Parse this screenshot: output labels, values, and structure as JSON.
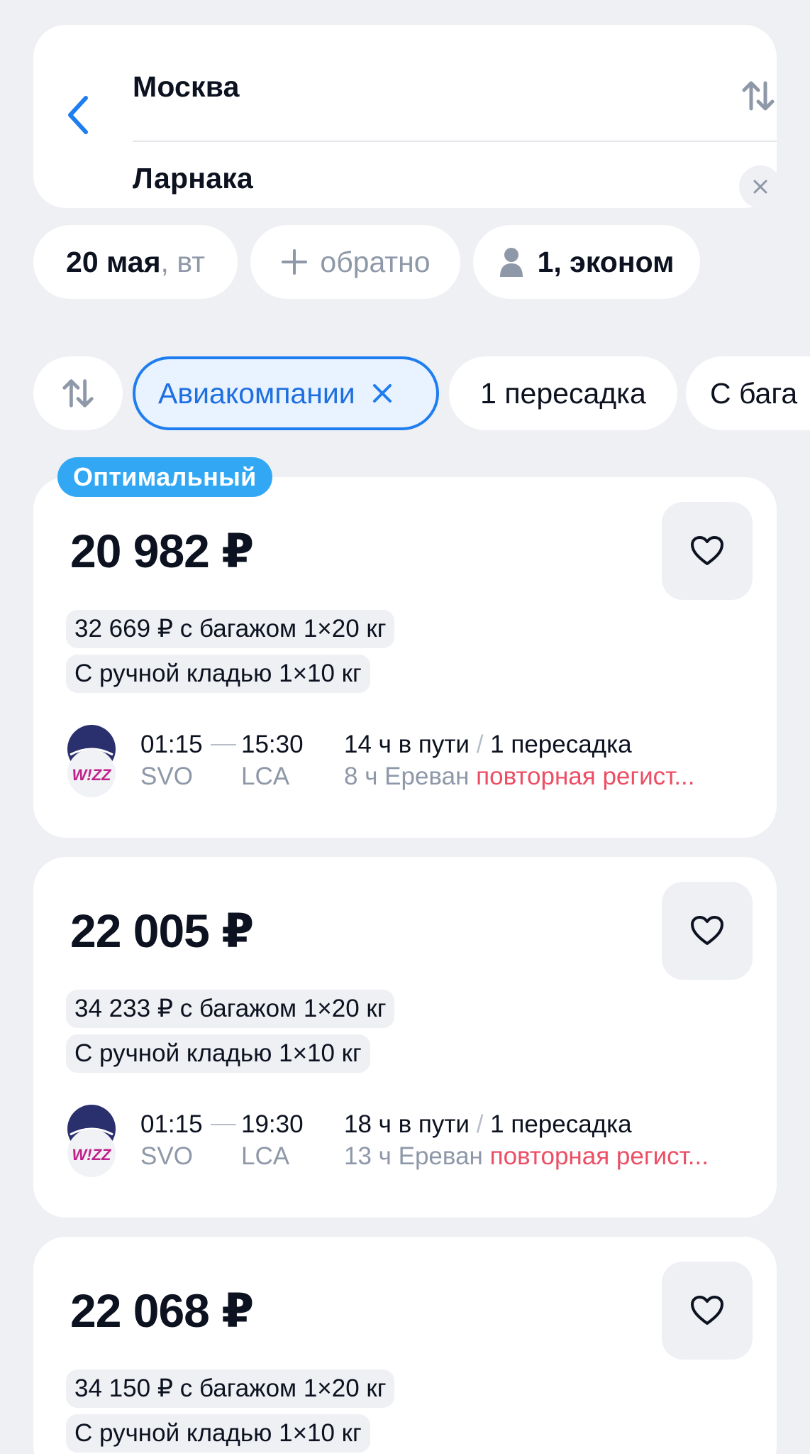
{
  "search": {
    "from": "Москва",
    "to": "Ларнака"
  },
  "params": {
    "date": "20 мая",
    "weekday": ", вт",
    "return_label": "обратно",
    "passengers": "1, эконом"
  },
  "filters": {
    "airlines": "Авиакомпании",
    "transfer": "1 пересадка",
    "baggage": "С бага"
  },
  "badge": "Оптимальный",
  "tickets": [
    {
      "price": "20 982 ₽",
      "baggage_price": "32 669 ₽ с багажом 1×20 кг",
      "hand_luggage": "С ручной кладью 1×10 кг",
      "depart_time": "01:15",
      "arrive_time": "15:30",
      "depart_code": "SVO",
      "arrive_code": "LCA",
      "duration": "14 ч в пути",
      "transfers": "1 пересадка",
      "layover": "8 ч Ереван",
      "warning": "повторная регист..."
    },
    {
      "price": "22 005 ₽",
      "baggage_price": "34 233 ₽ с багажом 1×20 кг",
      "hand_luggage": "С ручной кладью 1×10 кг",
      "depart_time": "01:15",
      "arrive_time": "19:30",
      "depart_code": "SVO",
      "arrive_code": "LCA",
      "duration": "18 ч в пути",
      "transfers": "1 пересадка",
      "layover": "13 ч Ереван",
      "warning": "повторная регист..."
    },
    {
      "price": "22 068 ₽",
      "baggage_price": "34 150 ₽ с багажом 1×20 кг",
      "hand_luggage": "С ручной кладью 1×10 кг"
    }
  ],
  "icons": {
    "back": "chevron-left-icon",
    "swap": "swap-vertical-icon",
    "clear": "close-icon",
    "plus": "plus-icon",
    "person": "person-icon",
    "sort": "sort-icon",
    "remove_filter": "close-icon",
    "favorite": "heart-icon",
    "airline_logo": "airline-logo-icon"
  },
  "colors": {
    "accent": "#1e7df0",
    "badge": "#32a8f5",
    "warning": "#ec4e64",
    "muted": "#8e98a8",
    "background": "#eef0f4"
  }
}
